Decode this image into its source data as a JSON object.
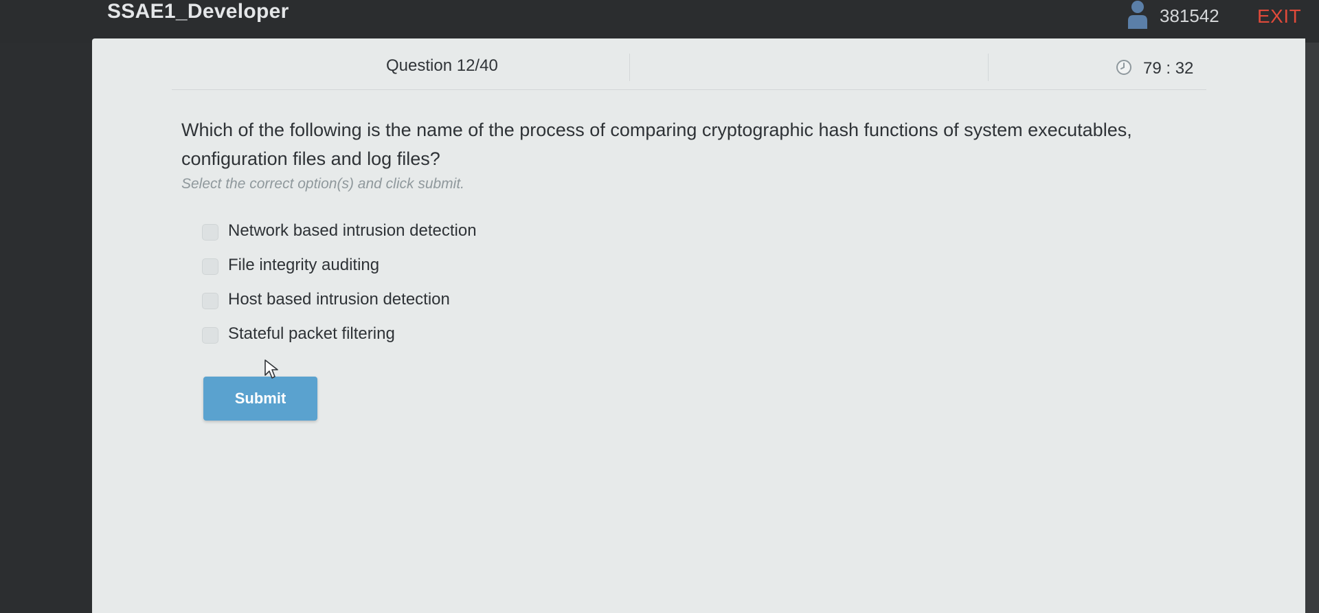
{
  "header": {
    "app_title": "SSAE1_Developer",
    "user_id": "381542",
    "exit_label": "EXIT",
    "user_icon": "user-icon"
  },
  "quiz": {
    "question_counter": "Question 12/40",
    "timer": "79 : 32",
    "timer_icon": "clock-icon",
    "question_text": "Which of the following is the name of the process of comparing cryptographic hash functions of system executables, configuration files and log files?",
    "instruction": "Select the correct option(s) and click submit.",
    "options": [
      {
        "label": "Network based intrusion detection",
        "checked": false
      },
      {
        "label": "File integrity auditing",
        "checked": false
      },
      {
        "label": "Host based intrusion detection",
        "checked": false
      },
      {
        "label": "Stateful packet filtering",
        "checked": false
      }
    ],
    "submit_label": "Submit"
  },
  "colors": {
    "exit": "#e04a3a",
    "submit": "#5aa2cf",
    "panel": "#e7eaea",
    "topbar": "#2b2d2f"
  }
}
